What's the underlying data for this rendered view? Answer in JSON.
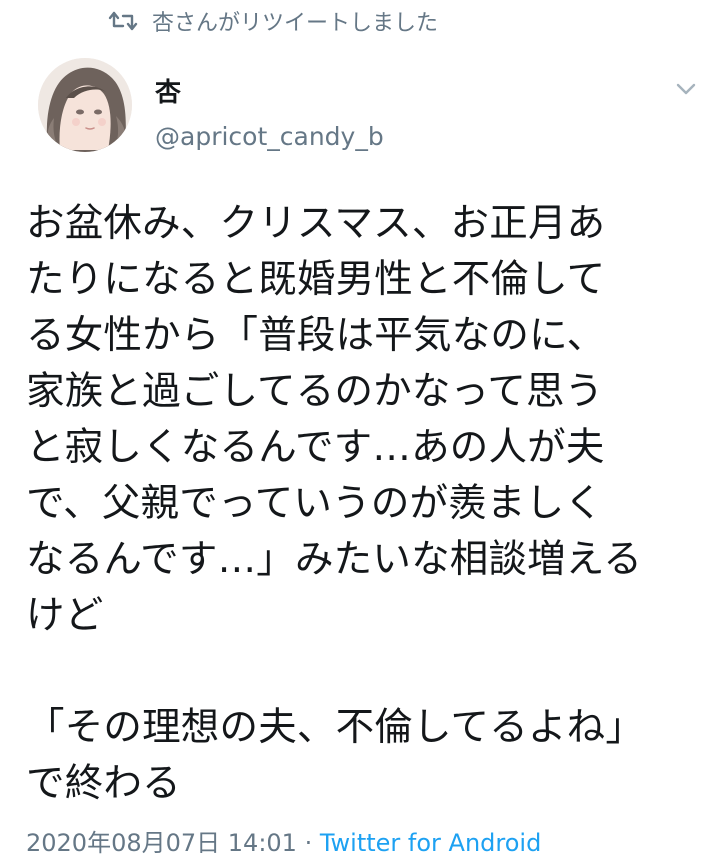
{
  "retweet": {
    "icon": "retweet-icon",
    "text": "杏さんがリツイートしました"
  },
  "author": {
    "name": "杏",
    "handle": "@apricot_candy_b",
    "avatar_icon": "avatar-illustration"
  },
  "menu": {
    "icon": "chevron-down-icon"
  },
  "tweet": {
    "lines": [
      "お盆休み、クリスマス、お正月あ",
      "たりになると既婚男性と不倫して",
      "る女性から「普段は平気なのに、",
      "家族と過ごしてるのかなって思う",
      "と寂しくなるんです…あの人が夫",
      "で、父親でっていうのが羨ましく",
      "なるんです…」みたいな相談増える",
      "けど",
      "",
      "「その理想の夫、不倫してるよね」",
      "で終わる"
    ]
  },
  "meta": {
    "timestamp": "2020年08月07日 14:01",
    "separator": " · ",
    "source": "Twitter for Android"
  },
  "colors": {
    "text": "#14171a",
    "muted": "#657786",
    "link": "#1da1f2"
  }
}
